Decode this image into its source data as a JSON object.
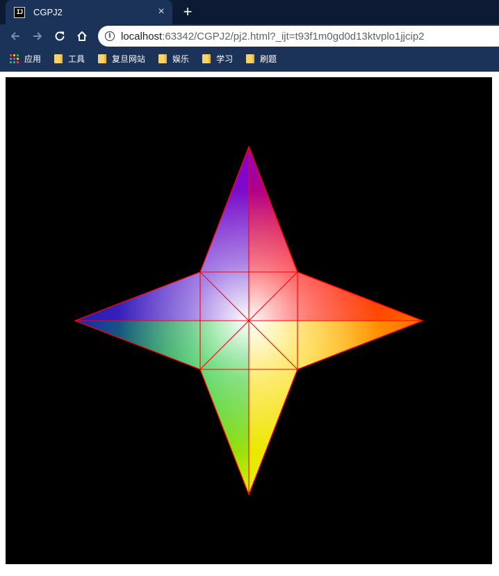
{
  "tab": {
    "title": "CGPJ2",
    "favicon_text": "IJ",
    "close_glyph": "×"
  },
  "new_tab_glyph": "+",
  "address_bar": {
    "host": "localhost",
    "rest": ":63342/CGPJ2/pj2.html?_ijt=t93f1m0gd0d13ktvplo1jjcip2"
  },
  "icons": [
    "back-icon",
    "forward-icon",
    "reload-icon",
    "home-icon",
    "info-icon",
    "apps-icon",
    "folder-icon"
  ],
  "bookmarks": [
    {
      "label": "应用",
      "icon": "apps"
    },
    {
      "label": "工具",
      "icon": "folder"
    },
    {
      "label": "复旦网站",
      "icon": "folder"
    },
    {
      "label": "娱乐",
      "icon": "folder"
    },
    {
      "label": "学习",
      "icon": "folder"
    },
    {
      "label": "刷题",
      "icon": "folder"
    }
  ],
  "scene": {
    "background": "#000000",
    "edge_color": "#ff0000",
    "center_color": "#ffffff",
    "vertex_colors": {
      "top": "#8a00c8",
      "right": "#ff6a00",
      "bottom": "#e2f000",
      "left": "#2020b0",
      "upper_right": "#ff0000",
      "lower_right": "#ffd800",
      "lower_left": "#00c020",
      "upper_left": "#6020d0"
    }
  }
}
